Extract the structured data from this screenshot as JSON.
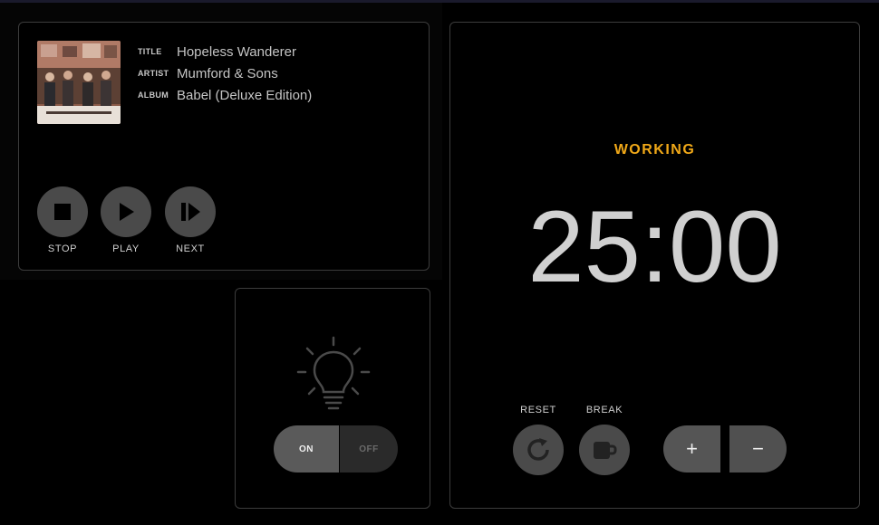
{
  "music": {
    "title_key": "TITLE",
    "title": "Hopeless Wanderer",
    "artist_key": "ARTIST",
    "artist": "Mumford & Sons",
    "album_key": "ALBUM",
    "album": "Babel (Deluxe Edition)",
    "controls": {
      "stop": "STOP",
      "play": "PLAY",
      "next": "NEXT"
    }
  },
  "light": {
    "on_label": "ON",
    "off_label": "OFF",
    "state": "on"
  },
  "timer": {
    "status": "WORKING",
    "time": "25:00",
    "reset_label": "RESET",
    "break_label": "BREAK",
    "plus": "+",
    "minus": "−",
    "accent": "#f0a818"
  }
}
